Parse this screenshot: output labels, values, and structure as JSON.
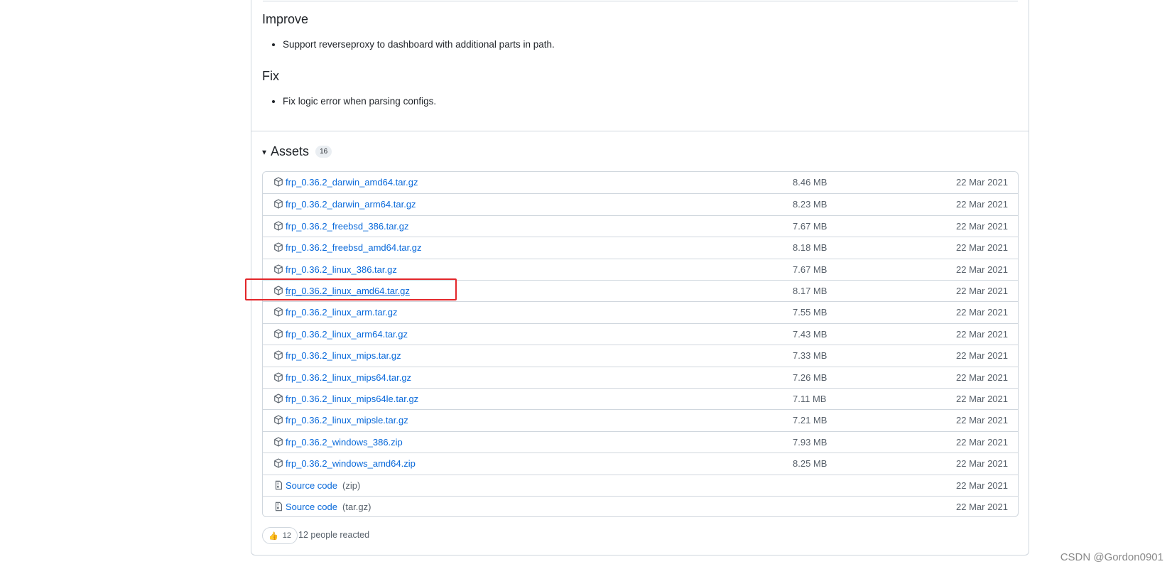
{
  "release": {
    "sections": [
      {
        "heading": "Improve",
        "items": [
          "Support reverseproxy to dashboard with additional parts in path."
        ]
      },
      {
        "heading": "Fix",
        "items": [
          "Fix logic error when parsing configs."
        ]
      }
    ]
  },
  "assets": {
    "caret_glyph": "▾",
    "title": "Assets",
    "count": "16",
    "items": [
      {
        "name": "frp_0.36.2_darwin_amd64.tar.gz",
        "size": "8.46 MB",
        "date": "22 Mar 2021",
        "icon": "package-icon"
      },
      {
        "name": "frp_0.36.2_darwin_arm64.tar.gz",
        "size": "8.23 MB",
        "date": "22 Mar 2021",
        "icon": "package-icon"
      },
      {
        "name": "frp_0.36.2_freebsd_386.tar.gz",
        "size": "7.67 MB",
        "date": "22 Mar 2021",
        "icon": "package-icon"
      },
      {
        "name": "frp_0.36.2_freebsd_amd64.tar.gz",
        "size": "8.18 MB",
        "date": "22 Mar 2021",
        "icon": "package-icon"
      },
      {
        "name": "frp_0.36.2_linux_386.tar.gz",
        "size": "7.67 MB",
        "date": "22 Mar 2021",
        "icon": "package-icon"
      },
      {
        "name": "frp_0.36.2_linux_amd64.tar.gz",
        "size": "8.17 MB",
        "date": "22 Mar 2021",
        "icon": "package-icon",
        "highlighted": true
      },
      {
        "name": "frp_0.36.2_linux_arm.tar.gz",
        "size": "7.55 MB",
        "date": "22 Mar 2021",
        "icon": "package-icon"
      },
      {
        "name": "frp_0.36.2_linux_arm64.tar.gz",
        "size": "7.43 MB",
        "date": "22 Mar 2021",
        "icon": "package-icon"
      },
      {
        "name": "frp_0.36.2_linux_mips.tar.gz",
        "size": "7.33 MB",
        "date": "22 Mar 2021",
        "icon": "package-icon"
      },
      {
        "name": "frp_0.36.2_linux_mips64.tar.gz",
        "size": "7.26 MB",
        "date": "22 Mar 2021",
        "icon": "package-icon"
      },
      {
        "name": "frp_0.36.2_linux_mips64le.tar.gz",
        "size": "7.11 MB",
        "date": "22 Mar 2021",
        "icon": "package-icon"
      },
      {
        "name": "frp_0.36.2_linux_mipsle.tar.gz",
        "size": "7.21 MB",
        "date": "22 Mar 2021",
        "icon": "package-icon"
      },
      {
        "name": "frp_0.36.2_windows_386.zip",
        "size": "7.93 MB",
        "date": "22 Mar 2021",
        "icon": "package-icon"
      },
      {
        "name": "frp_0.36.2_windows_amd64.zip",
        "size": "8.25 MB",
        "date": "22 Mar 2021",
        "icon": "package-icon"
      },
      {
        "name": "Source code",
        "sub": "(zip)",
        "size": "",
        "date": "22 Mar 2021",
        "icon": "file-zip-icon"
      },
      {
        "name": "Source code",
        "sub": "(tar.gz)",
        "size": "",
        "date": "22 Mar 2021",
        "icon": "file-zip-icon"
      }
    ]
  },
  "reactions": {
    "emoji": "👍",
    "count": "12",
    "summary": "12 people reacted"
  },
  "watermark": "CSDN @Gordon0901",
  "colors": {
    "link": "#0969da",
    "border": "#d0d7de",
    "highlight": "#e3262a",
    "muted": "#57606a"
  }
}
